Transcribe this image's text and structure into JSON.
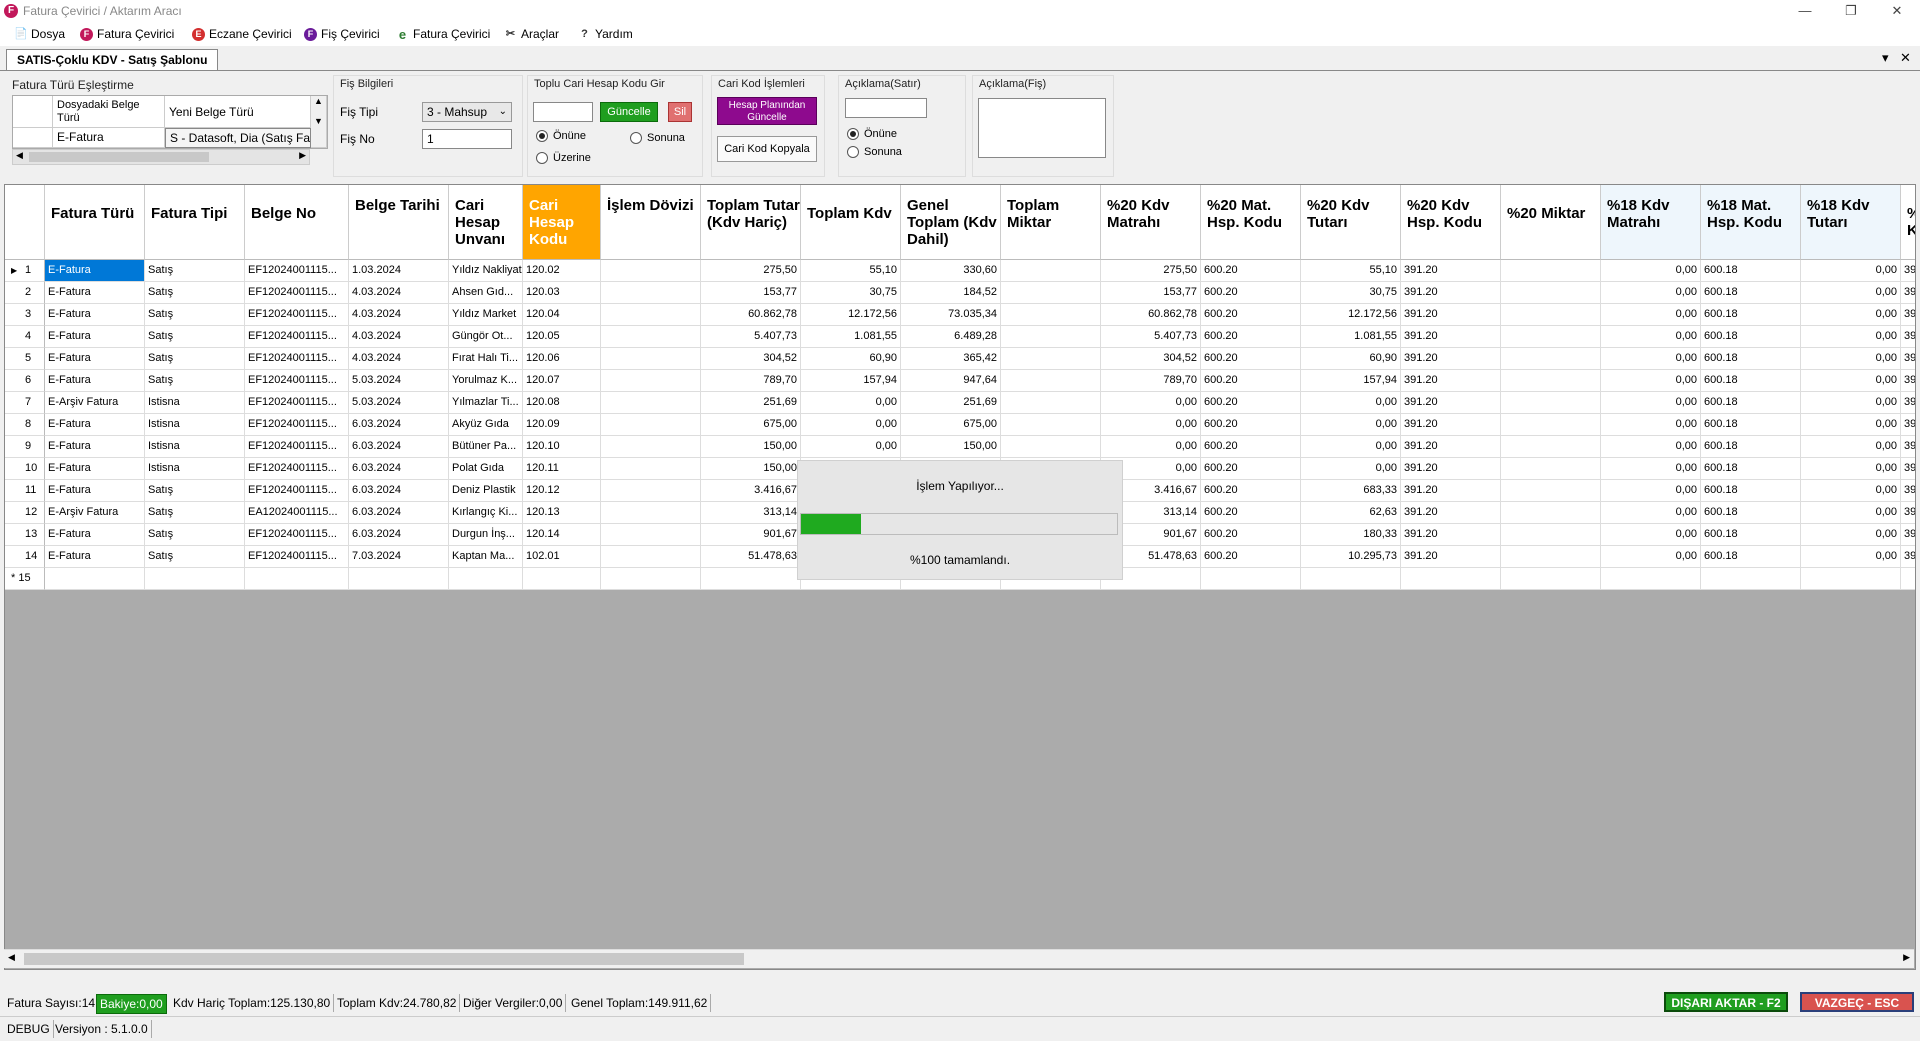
{
  "window": {
    "title": "Fatura Çevirici / Aktarım Aracı",
    "app_badge": "F"
  },
  "menu": [
    {
      "label": "Dosya",
      "badge": "",
      "color": "#ffffff"
    },
    {
      "label": "Fatura Çevirici",
      "badge": "F",
      "color": "#c2185b"
    },
    {
      "label": "Eczane Çevirici",
      "badge": "E",
      "color": "#d32f2f"
    },
    {
      "label": "Fiş Çevirici",
      "badge": "F",
      "color": "#6a1b9a"
    },
    {
      "label": "Fatura Çevirici",
      "badge": "e",
      "color": "#2e7d32"
    },
    {
      "label": "Araçlar",
      "badge": "",
      "color": "#ffffff"
    },
    {
      "label": "Yardım",
      "badge": "",
      "color": "#ffffff"
    }
  ],
  "tab": {
    "label": "SATIS-Çoklu KDV - Satış Şablonu",
    "collapse": "▾",
    "close": "✕"
  },
  "mapping": {
    "title": "Fatura Türü Eşleştirme",
    "col1": "Dosyadaki Belge Türü",
    "col2": "Yeni Belge Türü",
    "row_src": "E-Fatura",
    "row_dst": "S - Datasoft, Dia (Satış Fat"
  },
  "fis": {
    "title": "Fiş Bilgileri",
    "tip_label": "Fiş Tipi",
    "tip_value": "3 - Mahsup",
    "no_label": "Fiş No",
    "no_value": "1"
  },
  "toplu": {
    "title": "Toplu Cari Hesap Kodu Gir",
    "update": "Güncelle",
    "delete": "Sil",
    "opt1": "Önüne",
    "opt2": "Sonuna",
    "opt3": "Üzerine"
  },
  "cari": {
    "title": "Cari Kod İşlemleri",
    "btn1": "Hesap Planından Güncelle",
    "btn2": "Cari Kod Kopyala"
  },
  "aciklama_satir": {
    "title": "Açıklama(Satır)",
    "opt1": "Önüne",
    "opt2": "Sonuna"
  },
  "aciklama_fis": {
    "title": "Açıklama(Fiş)"
  },
  "columns": [
    "Fatura Türü",
    "Fatura Tipi",
    "Belge No",
    "Belge Tarihi",
    "Cari Hesap Unvanı",
    "Cari Hesap Kodu",
    "İşlem Dövizi",
    "Toplam Tutar (Kdv Hariç)",
    "Toplam Kdv",
    "Genel Toplam (Kdv Dahil)",
    "Toplam Miktar",
    "%20 Kdv Matrahı",
    "%20 Mat. Hsp. Kodu",
    "%20 Kdv Tutarı",
    "%20 Kdv Hsp. Kodu",
    "%20 Miktar",
    "%18 Kdv Matrahı",
    "%18 Mat. Hsp. Kodu",
    "%18 Kdv Tutarı",
    "%18 K"
  ],
  "rows": [
    {
      "n": "1",
      "t": "E-Fatura",
      "tip": "Satış",
      "no": "EF12024001115...",
      "d": "1.03.2024",
      "u": "Yıldız Nakliyat",
      "k": "120.02",
      "tt": "275,50",
      "kdv": "55,10",
      "gt": "330,60",
      "m20": "275,50",
      "h20": "600.20",
      "k20": "55,10",
      "kh20": "391.20",
      "m18": "0,00",
      "h18": "600.18",
      "k18": "0,00",
      "x": "39"
    },
    {
      "n": "2",
      "t": "E-Fatura",
      "tip": "Satış",
      "no": "EF12024001115...",
      "d": "4.03.2024",
      "u": "Ahsen Gıd...",
      "k": "120.03",
      "tt": "153,77",
      "kdv": "30,75",
      "gt": "184,52",
      "m20": "153,77",
      "h20": "600.20",
      "k20": "30,75",
      "kh20": "391.20",
      "m18": "0,00",
      "h18": "600.18",
      "k18": "0,00",
      "x": "39"
    },
    {
      "n": "3",
      "t": "E-Fatura",
      "tip": "Satış",
      "no": "EF12024001115...",
      "d": "4.03.2024",
      "u": "Yıldız Market",
      "k": "120.04",
      "tt": "60.862,78",
      "kdv": "12.172,56",
      "gt": "73.035,34",
      "m20": "60.862,78",
      "h20": "600.20",
      "k20": "12.172,56",
      "kh20": "391.20",
      "m18": "0,00",
      "h18": "600.18",
      "k18": "0,00",
      "x": "39"
    },
    {
      "n": "4",
      "t": "E-Fatura",
      "tip": "Satış",
      "no": "EF12024001115...",
      "d": "4.03.2024",
      "u": "Güngör Ot...",
      "k": "120.05",
      "tt": "5.407,73",
      "kdv": "1.081,55",
      "gt": "6.489,28",
      "m20": "5.407,73",
      "h20": "600.20",
      "k20": "1.081,55",
      "kh20": "391.20",
      "m18": "0,00",
      "h18": "600.18",
      "k18": "0,00",
      "x": "39"
    },
    {
      "n": "5",
      "t": "E-Fatura",
      "tip": "Satış",
      "no": "EF12024001115...",
      "d": "4.03.2024",
      "u": "Fırat Halı Ti...",
      "k": "120.06",
      "tt": "304,52",
      "kdv": "60,90",
      "gt": "365,42",
      "m20": "304,52",
      "h20": "600.20",
      "k20": "60,90",
      "kh20": "391.20",
      "m18": "0,00",
      "h18": "600.18",
      "k18": "0,00",
      "x": "39"
    },
    {
      "n": "6",
      "t": "E-Fatura",
      "tip": "Satış",
      "no": "EF12024001115...",
      "d": "5.03.2024",
      "u": "Yorulmaz K...",
      "k": "120.07",
      "tt": "789,70",
      "kdv": "157,94",
      "gt": "947,64",
      "m20": "789,70",
      "h20": "600.20",
      "k20": "157,94",
      "kh20": "391.20",
      "m18": "0,00",
      "h18": "600.18",
      "k18": "0,00",
      "x": "39"
    },
    {
      "n": "7",
      "t": "E-Arşiv Fatura",
      "tip": "Istisna",
      "no": "EF12024001115...",
      "d": "5.03.2024",
      "u": "Yılmazlar Ti...",
      "k": "120.08",
      "tt": "251,69",
      "kdv": "0,00",
      "gt": "251,69",
      "m20": "0,00",
      "h20": "600.20",
      "k20": "0,00",
      "kh20": "391.20",
      "m18": "0,00",
      "h18": "600.18",
      "k18": "0,00",
      "x": "39"
    },
    {
      "n": "8",
      "t": "E-Fatura",
      "tip": "Istisna",
      "no": "EF12024001115...",
      "d": "6.03.2024",
      "u": "Akyüz Gıda",
      "k": "120.09",
      "tt": "675,00",
      "kdv": "0,00",
      "gt": "675,00",
      "m20": "0,00",
      "h20": "600.20",
      "k20": "0,00",
      "kh20": "391.20",
      "m18": "0,00",
      "h18": "600.18",
      "k18": "0,00",
      "x": "39"
    },
    {
      "n": "9",
      "t": "E-Fatura",
      "tip": "Istisna",
      "no": "EF12024001115...",
      "d": "6.03.2024",
      "u": "Bütüner Pa...",
      "k": "120.10",
      "tt": "150,00",
      "kdv": "0,00",
      "gt": "150,00",
      "m20": "0,00",
      "h20": "600.20",
      "k20": "0,00",
      "kh20": "391.20",
      "m18": "0,00",
      "h18": "600.18",
      "k18": "0,00",
      "x": "39"
    },
    {
      "n": "10",
      "t": "E-Fatura",
      "tip": "Istisna",
      "no": "EF12024001115...",
      "d": "6.03.2024",
      "u": "Polat Gıda",
      "k": "120.11",
      "tt": "150,00",
      "kdv": "",
      "gt": "",
      "m20": "0,00",
      "h20": "600.20",
      "k20": "0,00",
      "kh20": "391.20",
      "m18": "0,00",
      "h18": "600.18",
      "k18": "0,00",
      "x": "39"
    },
    {
      "n": "11",
      "t": "E-Fatura",
      "tip": "Satış",
      "no": "EF12024001115...",
      "d": "6.03.2024",
      "u": "Deniz Plastik",
      "k": "120.12",
      "tt": "3.416,67",
      "kdv": "",
      "gt": "",
      "m20": "3.416,67",
      "h20": "600.20",
      "k20": "683,33",
      "kh20": "391.20",
      "m18": "0,00",
      "h18": "600.18",
      "k18": "0,00",
      "x": "39"
    },
    {
      "n": "12",
      "t": "E-Arşiv Fatura",
      "tip": "Satış",
      "no": "EA12024001115...",
      "d": "6.03.2024",
      "u": "Kırlangıç Ki...",
      "k": "120.13",
      "tt": "313,14",
      "kdv": "",
      "gt": "",
      "m20": "313,14",
      "h20": "600.20",
      "k20": "62,63",
      "kh20": "391.20",
      "m18": "0,00",
      "h18": "600.18",
      "k18": "0,00",
      "x": "39"
    },
    {
      "n": "13",
      "t": "E-Fatura",
      "tip": "Satış",
      "no": "EF12024001115...",
      "d": "6.03.2024",
      "u": "Durgun İnş...",
      "k": "120.14",
      "tt": "901,67",
      "kdv": "",
      "gt": "",
      "m20": "901,67",
      "h20": "600.20",
      "k20": "180,33",
      "kh20": "391.20",
      "m18": "0,00",
      "h18": "600.18",
      "k18": "0,00",
      "x": "39"
    },
    {
      "n": "14",
      "t": "E-Fatura",
      "tip": "Satış",
      "no": "EF12024001115...",
      "d": "7.03.2024",
      "u": "Kaptan Ma...",
      "k": "102.01",
      "tt": "51.478,63",
      "kdv": "",
      "gt": "",
      "m20": "51.478,63",
      "h20": "600.20",
      "k20": "10.295,73",
      "kh20": "391.20",
      "m18": "0,00",
      "h18": "600.18",
      "k18": "0,00",
      "x": "39"
    }
  ],
  "new_row_label": "* 15",
  "progress": {
    "title": "İşlem Yapılıyor...",
    "text": "%100 tamamlandı.",
    "fill_fraction": 0.19,
    "color": "#1faa1f"
  },
  "status": {
    "fatura_sayisi": "Fatura Sayısı:14",
    "bakiye": "Bakiye:0,00",
    "kdv_haric": "Kdv Hariç Toplam:125.130,80",
    "toplam_kdv": "Toplam Kdv:24.780,82",
    "diger": "Diğer Vergiler:0,00",
    "genel": "Genel Toplam:149.911,62",
    "export": "DIŞARI AKTAR - F2",
    "cancel": "VAZGEÇ - ESC"
  },
  "footer": {
    "mode": "DEBUG",
    "version": "Versiyon : 5.1.0.0"
  }
}
